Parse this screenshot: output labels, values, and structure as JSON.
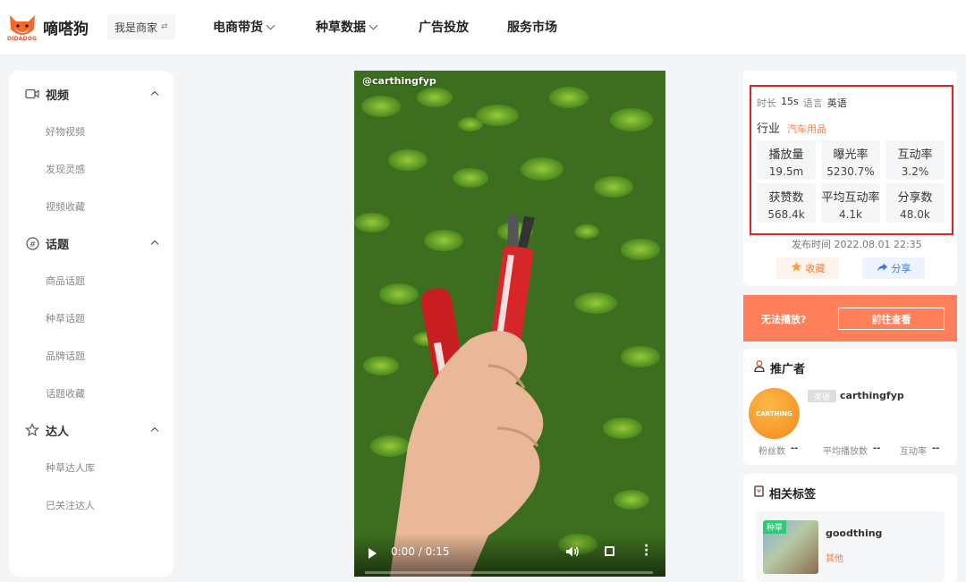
{
  "header": {
    "logo_text": "DIDADOG",
    "brand": "嘀嗒狗",
    "merchant_label": "我是商家",
    "nav": [
      {
        "label": "电商带货",
        "has_dropdown": true
      },
      {
        "label": "种草数据",
        "has_dropdown": true
      },
      {
        "label": "广告投放",
        "has_dropdown": false
      },
      {
        "label": "服务市场",
        "has_dropdown": false
      }
    ]
  },
  "sidebar": {
    "sections": [
      {
        "label": "视频",
        "icon": "video-icon",
        "items": [
          "好物视频",
          "发现灵感",
          "视频收藏"
        ]
      },
      {
        "label": "话题",
        "icon": "hashtag-icon",
        "items": [
          "商品话题",
          "种草话题",
          "品牌话题",
          "话题收藏"
        ]
      },
      {
        "label": "达人",
        "icon": "star-icon",
        "items": [
          "种草达人库",
          "已关注达人"
        ]
      }
    ]
  },
  "video": {
    "watermark": "@carthingfyp",
    "time": "0:00 / 0:15",
    "progress": 0
  },
  "info": {
    "duration_label": "时长",
    "duration": "15s",
    "language_label": "语言",
    "language": "英语",
    "industry_label": "行业",
    "industry": "汽车用品",
    "stats": [
      {
        "label": "播放量",
        "value": "19.5m"
      },
      {
        "label": "曝光率",
        "value": "5230.7%"
      },
      {
        "label": "互动率",
        "value": "3.2%"
      },
      {
        "label": "获赞数",
        "value": "568.4k"
      },
      {
        "label": "平均互动率",
        "value": "4.1k"
      },
      {
        "label": "分享数",
        "value": "48.0k"
      }
    ],
    "publish_label": "发布时间",
    "publish_time": "2022.08.01 22:35",
    "favorite_label": "收藏",
    "share_label": "分享",
    "highlight_color": "#e22222"
  },
  "banner": {
    "text": "无法播放?",
    "button": "前往查看"
  },
  "promoter": {
    "title": "推广者",
    "avatar_text": "CARTHING",
    "badge": "英语",
    "name": "carthingfyp",
    "stats": [
      {
        "label": "粉丝数",
        "value": "--"
      },
      {
        "label": "平均播放数",
        "value": "--"
      },
      {
        "label": "互动率",
        "value": "--"
      }
    ]
  },
  "tags": {
    "title": "相关标签",
    "items": [
      {
        "badge": "种草",
        "name": "goodthing",
        "type": "其他"
      }
    ]
  }
}
